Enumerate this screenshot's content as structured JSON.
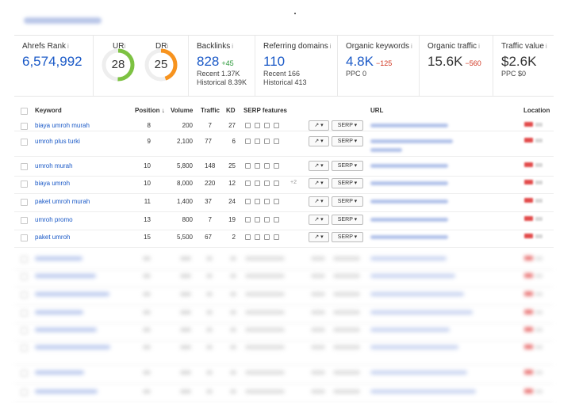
{
  "metrics": {
    "ahrefs_rank": {
      "label": "Ahrefs Rank",
      "value": "6,574,992"
    },
    "ur": {
      "label": "UR",
      "value": "28",
      "color": "#7dc242",
      "level": 0.28
    },
    "dr": {
      "label": "DR",
      "value": "25",
      "color": "#f7931e",
      "level": 0.25
    },
    "backlinks": {
      "label": "Backlinks",
      "value": "828",
      "delta": "+45",
      "recent": "Recent 1.37K",
      "historical": "Historical 8.39K"
    },
    "referring_domains": {
      "label": "Referring domains",
      "value": "110",
      "recent": "Recent 166",
      "historical": "Historical 413"
    },
    "organic_keywords": {
      "label": "Organic keywords",
      "value": "4.8K",
      "delta": "−125",
      "ppc": "PPC 0"
    },
    "organic_traffic": {
      "label": "Organic traffic",
      "value": "15.6K",
      "delta": "−560"
    },
    "traffic_value": {
      "label": "Traffic value",
      "value": "$2.6K",
      "ppc": "PPC $0"
    }
  },
  "table": {
    "headers": {
      "keyword": "Keyword",
      "position": "Position ↓",
      "volume": "Volume",
      "traffic": "Traffic",
      "kd": "KD",
      "serp_features": "SERP features",
      "url": "URL",
      "location": "Location"
    },
    "serp_button": "SERP ▾",
    "trend_button": "↗ ▾",
    "rows": [
      {
        "keyword": "biaya umroh murah",
        "position": "8",
        "volume": "200",
        "traffic": "7",
        "kd": "27"
      },
      {
        "keyword": "umroh plus turki",
        "position": "9",
        "volume": "2,100",
        "traffic": "77",
        "kd": "6"
      },
      {
        "keyword": "umroh murah",
        "position": "10",
        "volume": "5,800",
        "traffic": "148",
        "kd": "25"
      },
      {
        "keyword": "biaya umroh",
        "position": "10",
        "volume": "8,000",
        "traffic": "220",
        "kd": "12",
        "extra": "+2"
      },
      {
        "keyword": "paket umroh murah",
        "position": "11",
        "volume": "1,400",
        "traffic": "37",
        "kd": "24"
      },
      {
        "keyword": "umroh promo",
        "position": "13",
        "volume": "800",
        "traffic": "7",
        "kd": "19"
      },
      {
        "keyword": "paket umroh",
        "position": "15",
        "volume": "5,500",
        "traffic": "67",
        "kd": "2"
      }
    ]
  }
}
